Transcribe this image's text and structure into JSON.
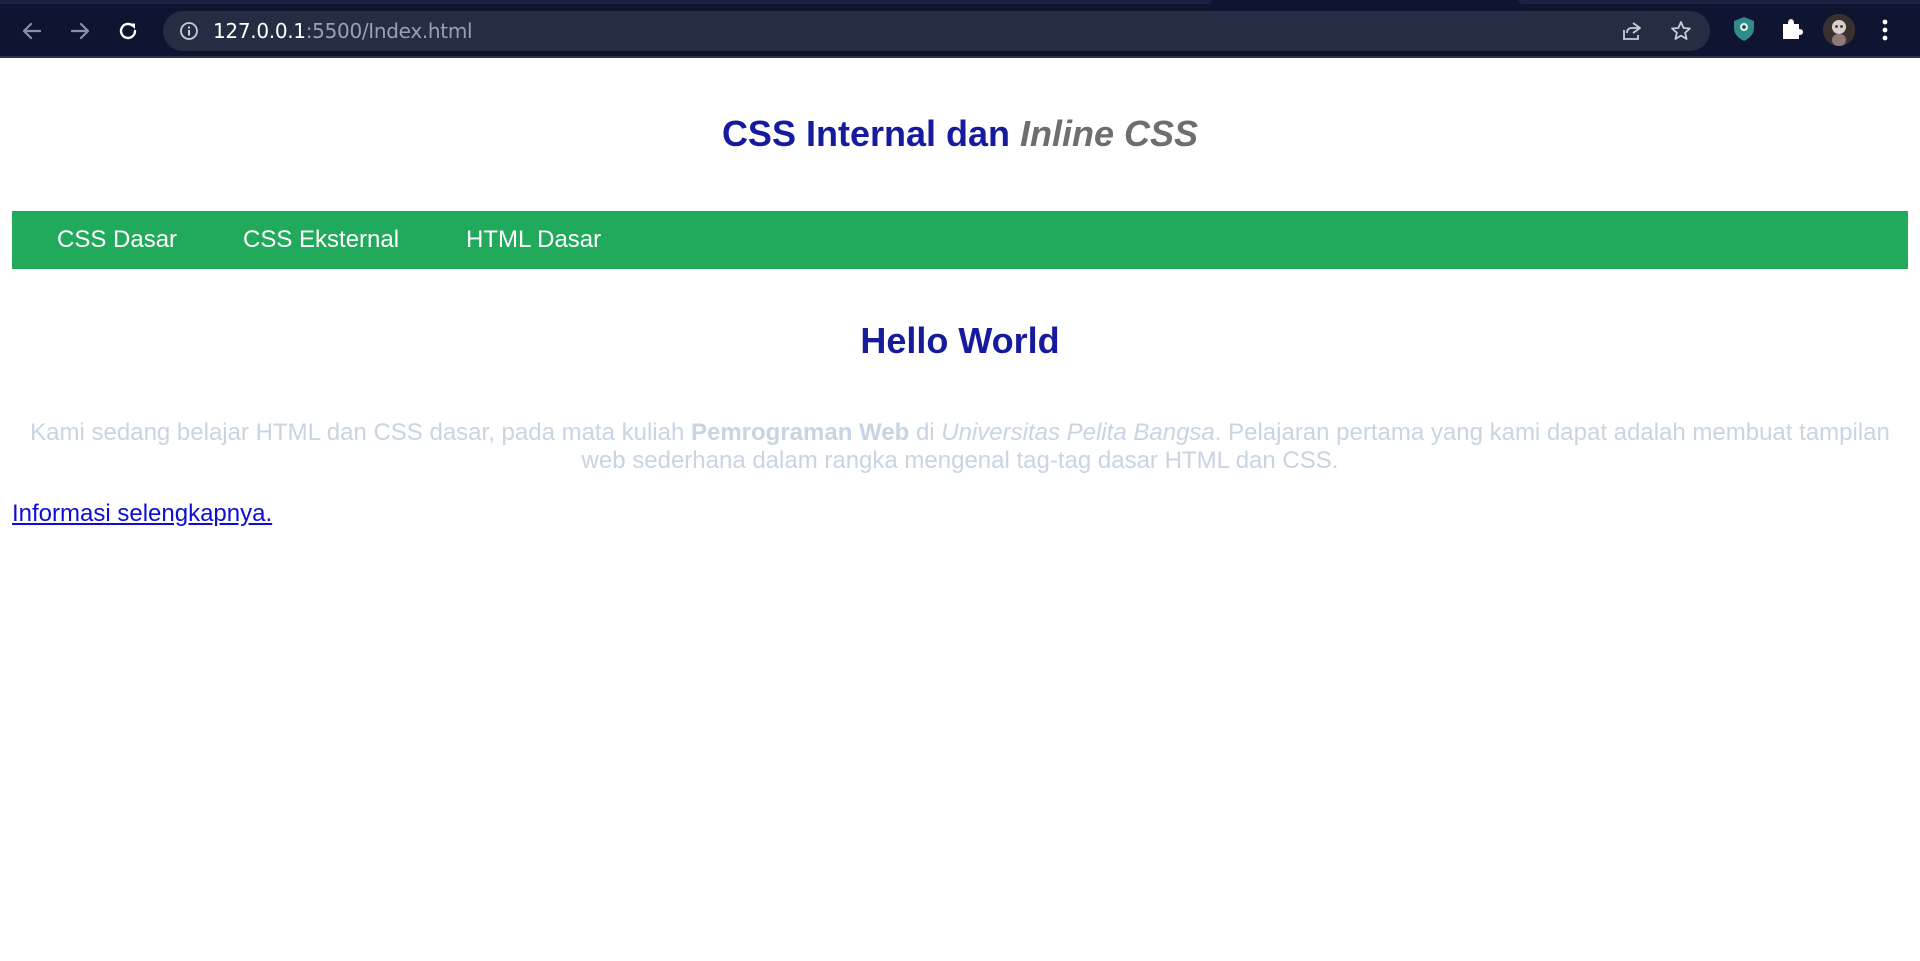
{
  "browser": {
    "url_host": "127.0.0.1",
    "url_rest": ":5500/Index.html",
    "icons": {
      "back": "arrow-left-icon",
      "forward": "arrow-right-icon",
      "reload": "reload-icon",
      "info": "info-icon",
      "share": "share-icon",
      "bookmark": "star-icon",
      "extension_1": "shield-extension-icon",
      "extension_2": "puzzle-icon",
      "profile": "avatar",
      "menu": "kebab-menu-icon"
    }
  },
  "page": {
    "title_part1": "CSS Internal dan ",
    "title_part2": "Inline",
    "title_part3": " CSS",
    "nav": [
      "CSS Dasar",
      "CSS Eksternal",
      "HTML Dasar"
    ],
    "heading": "Hello World",
    "paragraph": {
      "part1": "Kami sedang belajar HTML dan CSS dasar, pada mata kuliah ",
      "bold": "Pemrograman Web",
      "part2": " di ",
      "italic": "Universitas Pelita Bangsa",
      "part3": ". Pelajaran pertama yang kami dapat adalah membuat tampilan web sederhana dalam rangka mengenal tag-tag dasar HTML dan CSS."
    },
    "link": "Informasi selengkapnya."
  },
  "colors": {
    "chrome_bg": "#0f1430",
    "omnibox_bg": "#262c44",
    "title_blue": "#151b9c",
    "title_grey": "#6e6e6e",
    "navbar_green": "#21a95c",
    "paragraph": "#c9d4e2",
    "link": "#0d0dd6"
  }
}
